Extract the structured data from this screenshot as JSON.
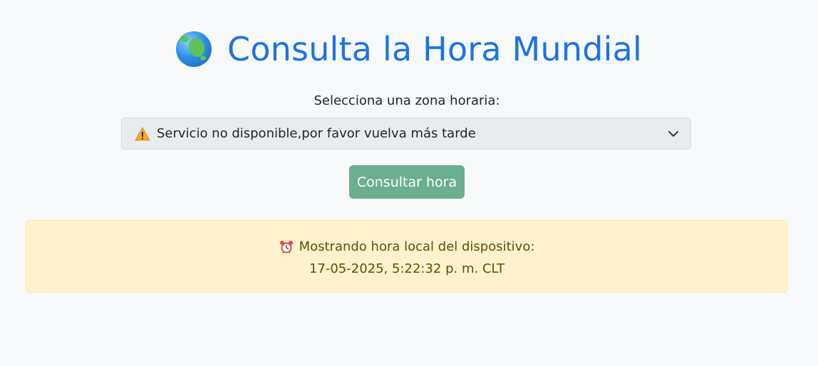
{
  "header": {
    "icon": "globe-icon",
    "title": "Consulta la Hora Mundial"
  },
  "form": {
    "label": "Selecciona una zona horaria:",
    "select": {
      "icon": "warning-icon",
      "selected": "Servicio no disponible,por favor vuelva más tarde"
    },
    "button_label": "Consultar hora"
  },
  "alert": {
    "icon": "alarm-clock-icon",
    "message": "Mostrando hora local del dispositivo:",
    "datetime": "17-05-2025, 5:22:32 p. m. CLT"
  },
  "colors": {
    "title": "#1a73e8",
    "button": "#6aaf8f",
    "alert_bg": "#fff3cd",
    "alert_text": "#664d03",
    "select_bg": "#e9ecef"
  }
}
